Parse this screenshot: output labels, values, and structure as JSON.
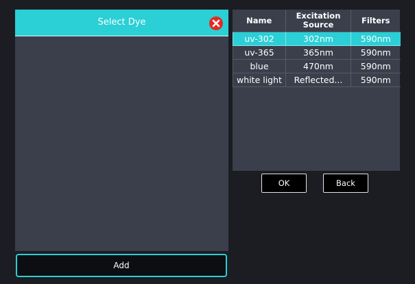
{
  "dialog": {
    "title": "Select Dye",
    "add_label": "Add"
  },
  "table": {
    "columns": [
      "Name",
      "Excitation Source",
      "Filters"
    ],
    "rows": [
      {
        "name": "uv-302",
        "source": "302nm",
        "filter": "590nm",
        "selected": true
      },
      {
        "name": "uv-365",
        "source": "365nm",
        "filter": "590nm",
        "selected": false
      },
      {
        "name": "blue",
        "source": "470nm",
        "filter": "590nm",
        "selected": false
      },
      {
        "name": "white light",
        "source": "Reflected...",
        "filter": "590nm",
        "selected": false
      }
    ]
  },
  "actions": {
    "ok_label": "OK",
    "back_label": "Back"
  },
  "colors": {
    "accent": "#2bcfd6",
    "panel": "#3a3f4b",
    "background": "#1b1d22",
    "close": "#e32a23"
  },
  "icons": {
    "close": "close-icon"
  }
}
